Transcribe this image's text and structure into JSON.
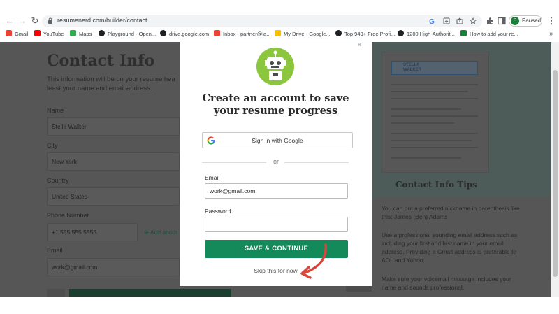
{
  "browser": {
    "url": "resumenerd.com/builder/contact",
    "profile_initial": "P",
    "profile_status": "Paused",
    "bookmarks": [
      {
        "label": "Gmail",
        "color": "#ea4335"
      },
      {
        "label": "YouTube",
        "color": "#ff0000"
      },
      {
        "label": "Maps",
        "color": "#34a853"
      },
      {
        "label": "Playground - Open...",
        "color": "#202124"
      },
      {
        "label": "drive.google.com",
        "color": "#202124"
      },
      {
        "label": "Inbox - partner@la...",
        "color": "#ea4335"
      },
      {
        "label": "My Drive - Google...",
        "color": "#fbbc04"
      },
      {
        "label": "Top 949+ Free Profi...",
        "color": "#202124"
      },
      {
        "label": "1200 High-Authorit...",
        "color": "#202124"
      },
      {
        "label": "How to add your re...",
        "color": "#188038"
      }
    ]
  },
  "page": {
    "title": "Contact Info",
    "subtitle": "This information will be on your resume hea least your name and email address.",
    "fields": [
      {
        "label": "Name",
        "value": "Stella Walker"
      },
      {
        "label": "City",
        "value": "New York"
      },
      {
        "label": "Country",
        "value": "United States"
      },
      {
        "label": "Phone Number",
        "value": "+1 555 555 5555"
      },
      {
        "label": "Email",
        "value": "work@gmail.com"
      }
    ],
    "add_link": "⊕ Add anoth",
    "preview_name": "STELLA WALKER",
    "tips_title": "Contact Info Tips",
    "tips": [
      "You can put a preferred nickname in parenthesis like this: James (Ben) Adams",
      "Use a professional sounding email address such as including your first and last name in your email address. Providing a Gmail address is preferable to AOL and Yahoo.",
      "Make sure your voicemail message includes your name and sounds professional."
    ]
  },
  "modal": {
    "close_label": "×",
    "title_line1": "Create an account to save",
    "title_line2": "your resume progress",
    "google_label": "Sign in with Google",
    "or_label": "or",
    "email_label": "Email",
    "email_value": "work@gmail.com",
    "password_label": "Password",
    "password_value": "",
    "save_label": "SAVE & CONTINUE",
    "skip_label": "Skip this for now"
  },
  "colors": {
    "accent_green": "#148a5b",
    "logo_green": "#8cc63f",
    "annotation_arrow": "#d9463b"
  }
}
